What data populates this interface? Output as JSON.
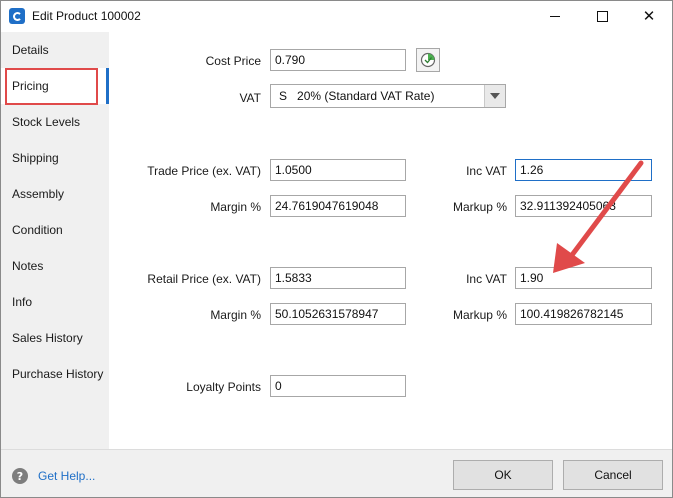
{
  "window": {
    "title": "Edit Product 100002",
    "icon": "app-logo-icon",
    "controls": {
      "minimize": "minimize-icon",
      "maximize": "maximize-icon",
      "close": "close-icon"
    }
  },
  "sidebar": {
    "items": [
      {
        "label": "Details"
      },
      {
        "label": "Pricing",
        "active": true
      },
      {
        "label": "Stock Levels"
      },
      {
        "label": "Shipping"
      },
      {
        "label": "Assembly"
      },
      {
        "label": "Condition"
      },
      {
        "label": "Notes"
      },
      {
        "label": "Info"
      },
      {
        "label": "Sales History"
      },
      {
        "label": "Purchase History"
      }
    ]
  },
  "pricing": {
    "cost_price": {
      "label": "Cost Price",
      "value": "0.790"
    },
    "vat": {
      "label": "VAT",
      "code": "S",
      "selected": "20% (Standard VAT Rate)"
    },
    "trade": {
      "price_label": "Trade Price (ex. VAT)",
      "price": "1.0500",
      "inc_vat_label": "Inc VAT",
      "inc_vat": "1.26",
      "margin_label": "Margin %",
      "margin": "24.7619047619048",
      "markup_label": "Markup %",
      "markup": "32.911392405063"
    },
    "retail": {
      "price_label": "Retail Price (ex. VAT)",
      "price": "1.5833",
      "inc_vat_label": "Inc VAT",
      "inc_vat": "1.90",
      "margin_label": "Margin %",
      "margin": "50.1052631578947",
      "markup_label": "Markup %",
      "markup": "100.419826782145"
    },
    "loyalty": {
      "label": "Loyalty Points",
      "value": "0"
    }
  },
  "footer": {
    "help_label": "Get Help...",
    "ok_label": "OK",
    "cancel_label": "Cancel"
  },
  "colors": {
    "accent": "#1f6fc7",
    "highlight": "#e04a4a",
    "sidebar_bg": "#f0f0f0"
  }
}
